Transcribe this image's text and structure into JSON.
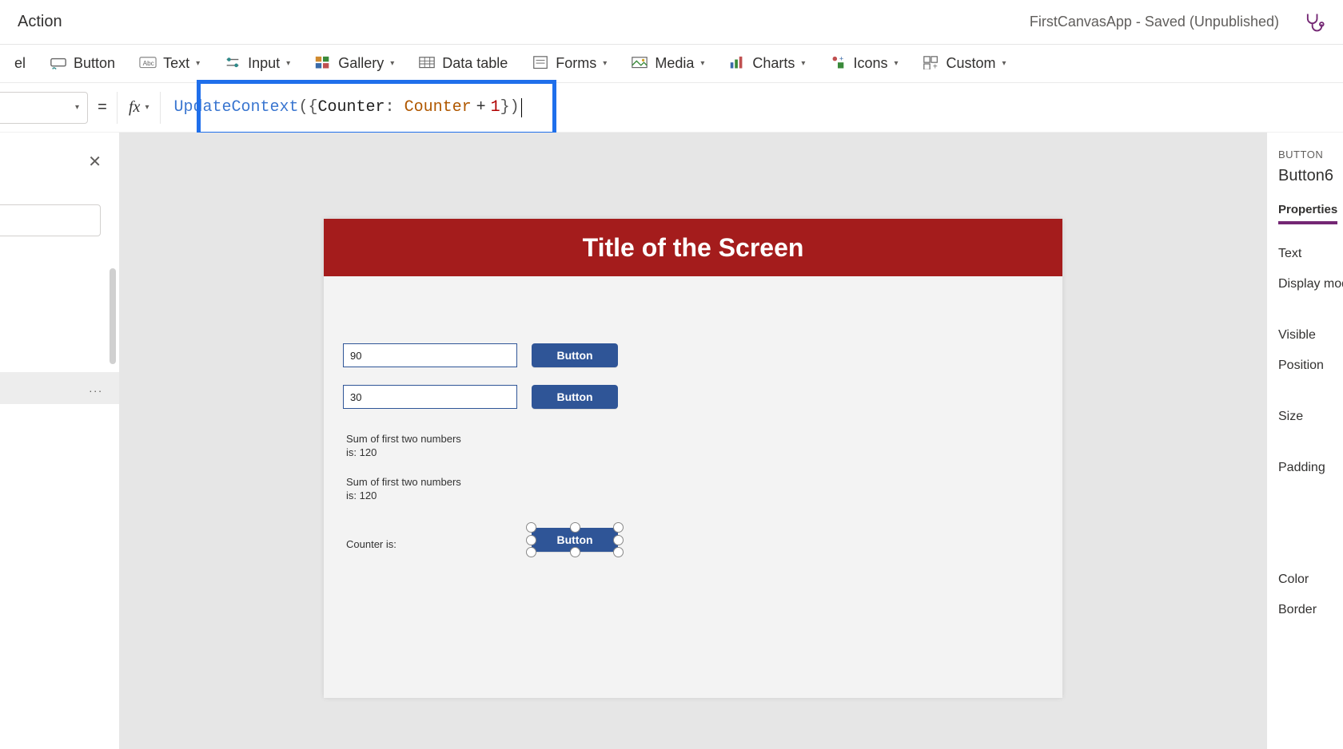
{
  "topbar": {
    "action_tab": "Action",
    "app_title": "FirstCanvasApp - Saved (Unpublished)"
  },
  "ribbon": {
    "partial_item": "el",
    "items": [
      {
        "label": "Button",
        "has_dropdown": false,
        "icon": "button"
      },
      {
        "label": "Text",
        "has_dropdown": true,
        "icon": "text"
      },
      {
        "label": "Input",
        "has_dropdown": true,
        "icon": "input"
      },
      {
        "label": "Gallery",
        "has_dropdown": true,
        "icon": "gallery"
      },
      {
        "label": "Data table",
        "has_dropdown": false,
        "icon": "datatable"
      },
      {
        "label": "Forms",
        "has_dropdown": true,
        "icon": "forms"
      },
      {
        "label": "Media",
        "has_dropdown": true,
        "icon": "media"
      },
      {
        "label": "Charts",
        "has_dropdown": true,
        "icon": "charts"
      },
      {
        "label": "Icons",
        "has_dropdown": true,
        "icon": "icons"
      },
      {
        "label": "Custom",
        "has_dropdown": true,
        "icon": "custom"
      }
    ]
  },
  "formula": {
    "fn": "UpdateContext",
    "open1": "(",
    "open2": "{",
    "field": "Counter",
    "colon": ":",
    "var": "Counter",
    "op": "+",
    "num": "1",
    "close2": "}",
    "close1": ")",
    "eq": "="
  },
  "left": {
    "tree_item_more": "..."
  },
  "canvas": {
    "title": "Title of the Screen",
    "input1_value": "90",
    "input2_value": "30",
    "btn_label": "Button",
    "sum_label1": "Sum of first two numbers is: 120",
    "sum_label2": "Sum of first two numbers is: 120",
    "counter_label": "Counter is:"
  },
  "rightpanel": {
    "type": "BUTTON",
    "name": "Button6",
    "tab": "Properties",
    "rows": [
      "Text",
      "Display mode"
    ],
    "group2": [
      "Visible",
      "Position"
    ],
    "group3": [
      "Size"
    ],
    "group4": [
      "Padding"
    ],
    "group5": [
      "Color",
      "Border"
    ]
  }
}
